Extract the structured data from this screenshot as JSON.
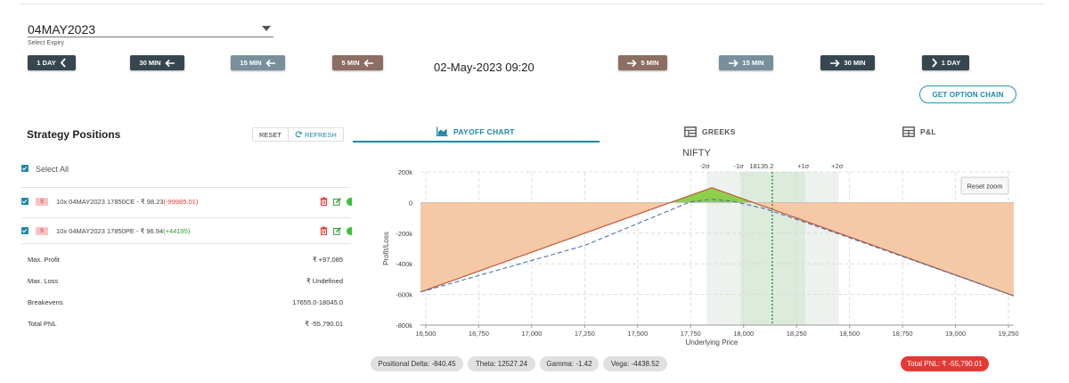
{
  "expiry": {
    "value": "04MAY2023",
    "label": "Select Expiry"
  },
  "time_nav": {
    "back_1day": "1 DAY",
    "back_30min": "30 MIN",
    "back_15min": "15 MIN",
    "back_5min": "5 MIN",
    "current": "02-May-2023 09:20",
    "fwd_5min": "5 MIN",
    "fwd_15min": "15 MIN",
    "fwd_30min": "30 MIN",
    "fwd_1day": "1 DAY"
  },
  "get_option_chain": "GET OPTION CHAIN",
  "strategy": {
    "title": "Strategy Positions",
    "reset": "RESET",
    "refresh": "REFRESH",
    "select_all": "Select All",
    "positions": [
      {
        "side": "S",
        "desc": "10x  04MAY2023  17850CE  - ₹ 98.23",
        "pnl": "(-99985.01)"
      },
      {
        "side": "S",
        "desc": "10x  04MAY2023  17850PE  - ₹ 96.94",
        "pnl": "(+44195)"
      }
    ],
    "summary": {
      "max_profit_label": "Max. Profit",
      "max_profit": "₹ +97,085",
      "max_loss_label": "Max. Loss",
      "max_loss": "₹ Undefined",
      "breakevens_label": "Breakevens",
      "breakevens": "17655.0-18045.0",
      "total_pnl_label": "Total PNL",
      "total_pnl": "₹ -55,790.01"
    }
  },
  "tabs": {
    "payoff": "PAYOFF CHART",
    "greeks": "GREEKS",
    "pnl": "P&L"
  },
  "stats": {
    "delta": "Positional Delta: -840.45",
    "theta": "Theta: 12527.24",
    "gamma": "Gamma: -1.42",
    "vega": "Vega: -4438.52",
    "total_pnl": "Total PNL: ₹ -55,790.01"
  },
  "colors": {
    "accent": "#1e88a8",
    "loss_fill": "#f6c9a6",
    "profit_fill": "#8ccf4a",
    "negative": "#e53935"
  },
  "chart_data": {
    "type": "line",
    "title": "NIFTY",
    "xlabel": "Underlying Price",
    "ylabel": "Profit/Loss",
    "xlim": [
      16475,
      19275
    ],
    "ylim": [
      -800000,
      200000
    ],
    "x_ticks": [
      16500,
      16750,
      17000,
      17250,
      17500,
      17750,
      18000,
      18250,
      18500,
      18750,
      19000,
      19250
    ],
    "x_tick_labels": [
      "16,500",
      "16,750",
      "17,000",
      "17,250",
      "17,500",
      "17,750",
      "18,000",
      "18,250",
      "18,500",
      "18,750",
      "19,000",
      "19,250"
    ],
    "y_ticks": [
      200000,
      0,
      -200000,
      -400000,
      -600000,
      -800000
    ],
    "y_tick_labels": [
      "200k",
      "0",
      "-200k",
      "-400k",
      "-600k",
      "-800k"
    ],
    "current_price": 18135.2,
    "current_price_label": "18135.2",
    "sigma_bands": [
      {
        "label": "-2σ",
        "x": 17825
      },
      {
        "label": "-1σ",
        "x": 17985
      },
      {
        "label": "+1σ",
        "x": 18290
      },
      {
        "label": "+2σ",
        "x": 18450
      }
    ],
    "series": [
      {
        "kind": "expiry_payoff",
        "x": [
          16475,
          17850,
          19275
        ],
        "y": [
          -584000,
          97085,
          -609000
        ]
      },
      {
        "kind": "t0_payoff",
        "x": [
          16475,
          17250,
          17600,
          17750,
          17850,
          17950,
          18100,
          18250,
          18500,
          19275
        ],
        "y": [
          -584000,
          -280000,
          -80000,
          5000,
          22000,
          8000,
          -40000,
          -110000,
          -230000,
          -609000
        ]
      }
    ],
    "reset_zoom": "Reset zoom"
  }
}
